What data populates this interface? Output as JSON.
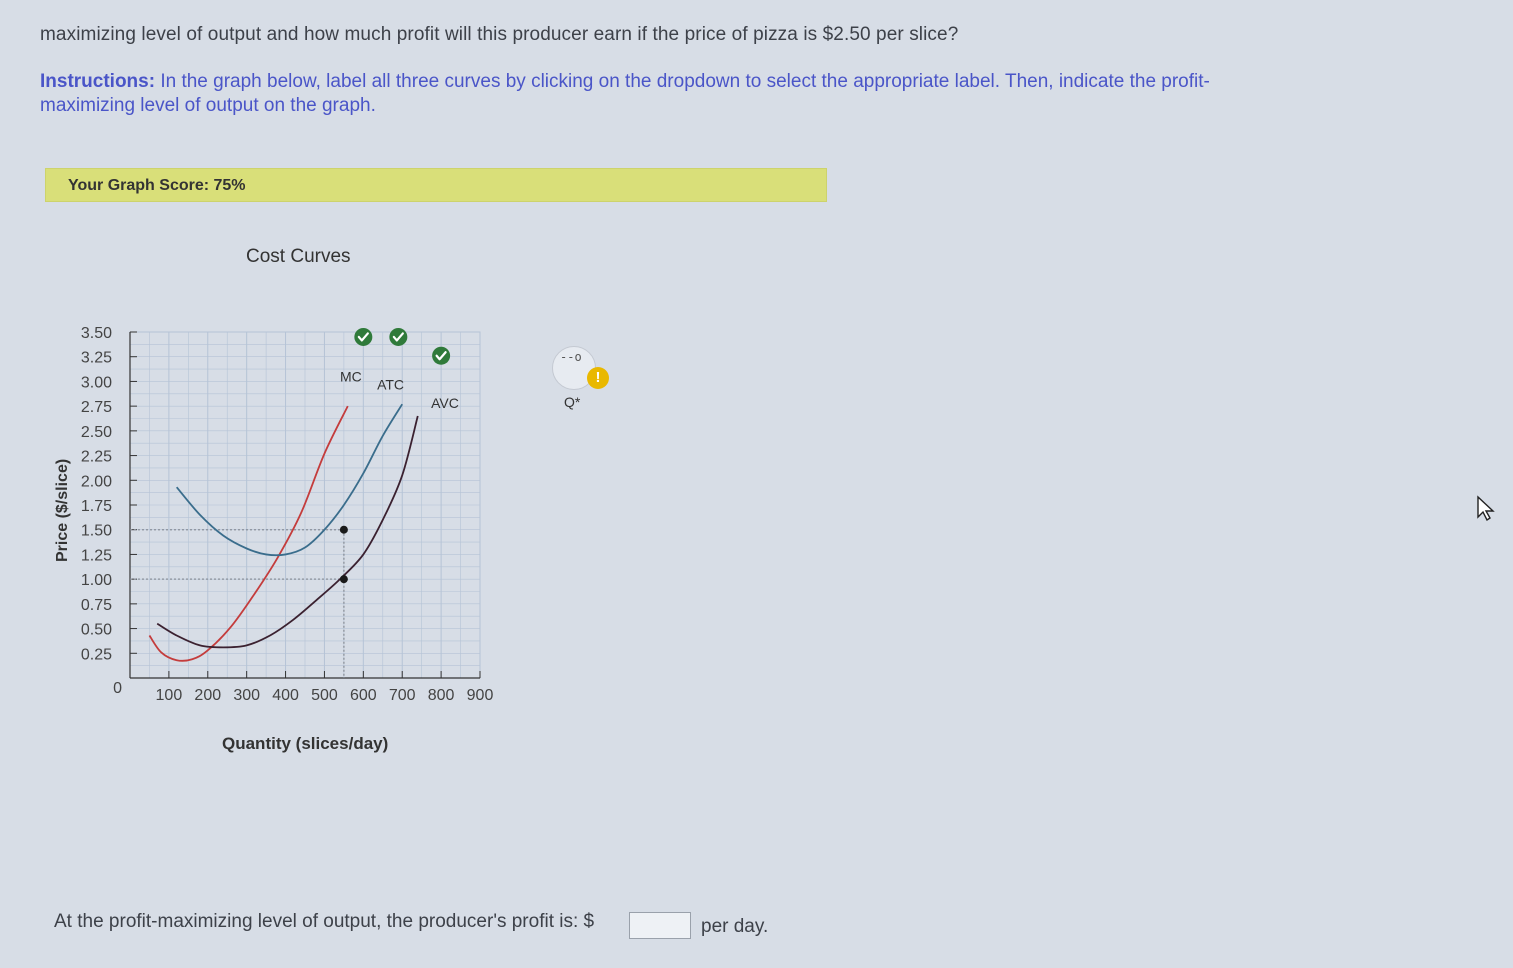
{
  "question": "maximizing level of output and how much profit will this producer earn if the price of pizza is $2.50 per slice?",
  "instructions": {
    "lead": "Instructions:",
    "text": " In the graph below, label all three curves by clicking on the dropdown to select the appropriate label. Then, indicate the profit-maximizing level of output on the graph."
  },
  "score": "Your Graph Score: 75%",
  "chart_data": {
    "type": "line",
    "title": "Cost Curves",
    "xlabel": "Quantity (slices/day)",
    "ylabel": "Price ($/slice)",
    "xlim": [
      0,
      900
    ],
    "ylim": [
      0,
      3.5
    ],
    "x_ticks": [
      100,
      200,
      300,
      400,
      500,
      600,
      700,
      800,
      900
    ],
    "x_tick_labels": [
      "100",
      "200",
      "300",
      "400",
      "500",
      "600",
      "700",
      "800",
      "900"
    ],
    "y_ticks": [
      0,
      0.25,
      0.5,
      0.75,
      1.0,
      1.25,
      1.5,
      1.75,
      2.0,
      2.25,
      2.5,
      2.75,
      3.0,
      3.25,
      3.5
    ],
    "y_tick_labels": [
      "0",
      "0.25",
      "0.50",
      "0.75",
      "1.00",
      "1.25",
      "1.50",
      "1.75",
      "2.00",
      "2.25",
      "2.50",
      "2.75",
      "3.00",
      "3.25",
      "3.50"
    ],
    "grid": true,
    "series": [
      {
        "name": "MC",
        "color": "#c43c3c",
        "x": [
          50,
          80,
          120,
          160,
          200,
          260,
          320,
          380,
          440,
          500,
          560
        ],
        "y": [
          0.43,
          0.26,
          0.18,
          0.19,
          0.28,
          0.52,
          0.85,
          1.22,
          1.67,
          2.27,
          2.75
        ]
      },
      {
        "name": "ATC",
        "color": "#3a6d8c",
        "x": [
          120,
          180,
          240,
          300,
          350,
          400,
          450,
          500,
          550,
          600,
          650,
          700
        ],
        "y": [
          1.93,
          1.65,
          1.44,
          1.31,
          1.25,
          1.25,
          1.32,
          1.5,
          1.75,
          2.07,
          2.45,
          2.77
        ]
      },
      {
        "name": "AVC",
        "color": "#3b2130",
        "x": [
          70,
          120,
          180,
          240,
          300,
          360,
          420,
          480,
          540,
          600,
          650,
          700,
          740
        ],
        "y": [
          0.55,
          0.43,
          0.33,
          0.31,
          0.33,
          0.43,
          0.59,
          0.79,
          1.0,
          1.25,
          1.6,
          2.05,
          2.65
        ]
      }
    ],
    "curve_labels": [
      {
        "text": "MC",
        "x": 568,
        "y": 3.0
      },
      {
        "text": "ATC",
        "x": 670,
        "y": 2.92
      },
      {
        "text": "AVC",
        "x": 810,
        "y": 2.73
      }
    ],
    "checkmarks": [
      {
        "x": 600,
        "y": 3.45
      },
      {
        "x": 690,
        "y": 3.45
      },
      {
        "x": 800,
        "y": 3.26
      }
    ],
    "points": [
      {
        "x": 550,
        "y": 1.5
      },
      {
        "x": 550,
        "y": 1.0
      }
    ],
    "guide_lines": [
      {
        "from": [
          0,
          1.5
        ],
        "to": [
          550,
          1.5
        ]
      },
      {
        "from": [
          0,
          1.0
        ],
        "to": [
          550,
          1.0
        ]
      },
      {
        "from": [
          550,
          1.5
        ],
        "to": [
          550,
          0
        ]
      }
    ],
    "colors": {
      "grid": "#b5c3d6",
      "axis": "#333333",
      "guide": "#8a9099",
      "check": "#2f7a3a",
      "point": "#1a1a1a"
    }
  },
  "tool": {
    "label": "Q*",
    "glyph": "--o",
    "warn": "!"
  },
  "answer": {
    "prefix": "At the profit-maximizing level of output, the producer's profit is: $",
    "value": "",
    "suffix": "per day."
  }
}
